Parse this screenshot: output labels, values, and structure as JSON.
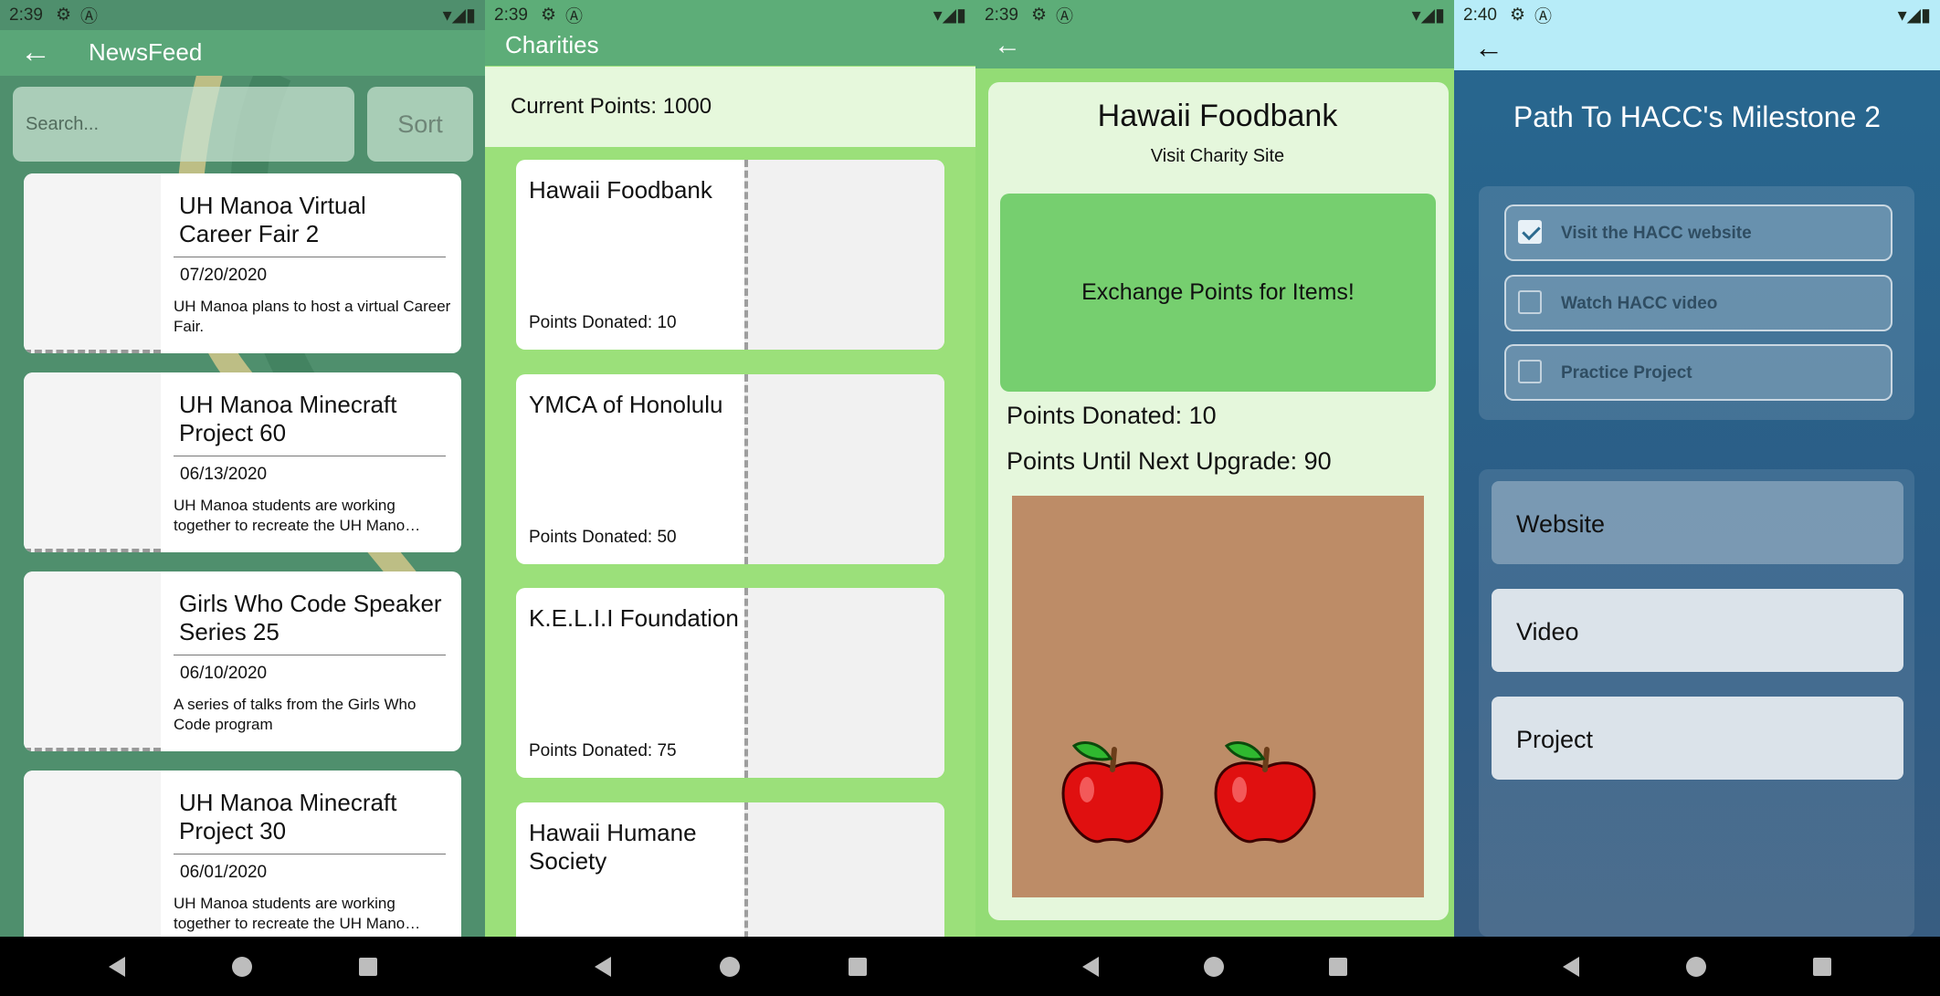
{
  "status": {
    "s1_time": "2:39",
    "s2_time": "2:39",
    "s3_time": "2:39",
    "s4_time": "2:40"
  },
  "newsfeed": {
    "title": "NewsFeed",
    "search_placeholder": "Search...",
    "sort_label": "Sort",
    "items": [
      {
        "title": "UH Manoa Virtual Career Fair 2",
        "date": "07/20/2020",
        "desc": "UH Manoa plans to host a virtual Career Fair."
      },
      {
        "title": "UH Manoa Minecraft Project 60",
        "date": "06/13/2020",
        "desc": "UH Manoa students are working together to recreate the UH Mano…"
      },
      {
        "title": "Girls Who Code Speaker Series 25",
        "date": "06/10/2020",
        "desc": "A series of talks from the Girls Who Code program"
      },
      {
        "title": "UH Manoa Minecraft Project 30",
        "date": "06/01/2020",
        "desc": "UH Manoa students are working together to recreate the UH Mano…"
      }
    ]
  },
  "charities": {
    "title": "Charities",
    "current_points": "Current Points: 1000",
    "items": [
      {
        "name": "Hawaii Foodbank",
        "points": "Points Donated: 10"
      },
      {
        "name": "YMCA of Honolulu",
        "points": "Points Donated: 50"
      },
      {
        "name": "K.E.L.I.I Foundation",
        "points": "Points Donated: 75"
      },
      {
        "name": "Hawaii Humane Society",
        "points": ""
      }
    ]
  },
  "charity_detail": {
    "name": "Hawaii Foodbank",
    "visit": "Visit Charity Site",
    "exchange": "Exchange Points for Items!",
    "points_donated": "Points Donated: 10",
    "points_until": "Points Until Next Upgrade: 90"
  },
  "milestone": {
    "title": "Path To HACC's Milestone 2",
    "tasks": [
      {
        "label": "Visit the HACC website",
        "checked": true
      },
      {
        "label": "Watch HACC video",
        "checked": false
      },
      {
        "label": "Practice Project",
        "checked": false
      }
    ],
    "links": [
      "Website",
      "Video",
      "Project"
    ]
  },
  "colors": {
    "green_bar": "#5dad78",
    "apple": "#e01010",
    "board": "#bd8c67",
    "milestone_bg": "#2c5c85"
  }
}
